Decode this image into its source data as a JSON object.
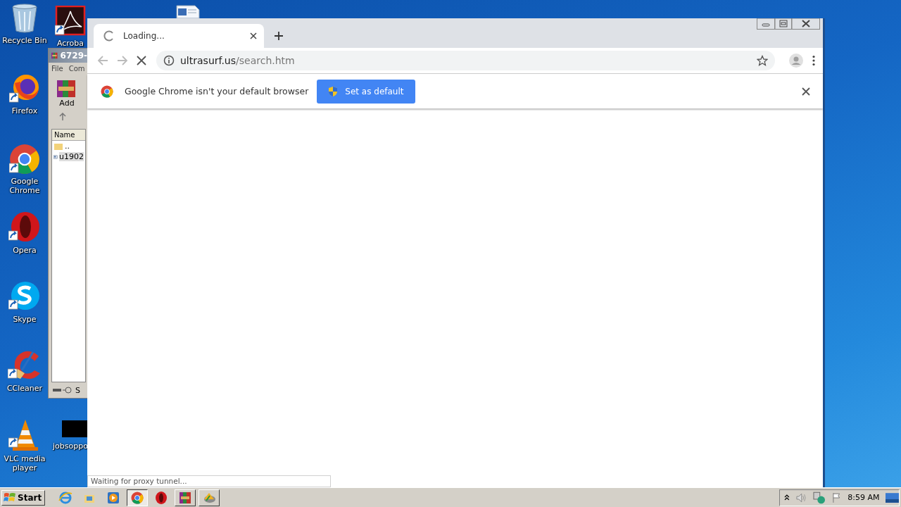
{
  "desktop_icons": [
    {
      "label": "Recycle Bin",
      "kind": "recycle"
    },
    {
      "label": "Firefox",
      "kind": "firefox"
    },
    {
      "label": "Google Chrome",
      "kind": "chrome"
    },
    {
      "label": "Opera",
      "kind": "opera"
    },
    {
      "label": "Skype",
      "kind": "skype"
    },
    {
      "label": "CCleaner",
      "kind": "ccleaner"
    },
    {
      "label": "VLC media player",
      "kind": "vlc"
    },
    {
      "label": "Acroba",
      "kind": "acrobat"
    },
    {
      "label": "jobsoppo",
      "kind": "thumbnail"
    },
    {
      "kind": "document"
    }
  ],
  "archive_window": {
    "title": "6729-",
    "menu": [
      "File",
      "Com"
    ],
    "toolbar": [
      "Add"
    ],
    "columns": [
      "Name"
    ],
    "rows": [
      {
        "name": "..",
        "kind": "folder"
      },
      {
        "name": "u1902",
        "kind": "file"
      }
    ],
    "status": "S"
  },
  "browser": {
    "loading": true,
    "tabs": [
      {
        "title": "Loading...",
        "selected": true
      }
    ],
    "address": {
      "host": "ultrasurf.us",
      "path": "/search.htm"
    },
    "infobar": {
      "message": "Google Chrome isn't your default browser",
      "button": "Set as default"
    },
    "status_bubble": "Waiting for proxy tunnel..."
  },
  "taskbar": {
    "start": "Start",
    "apps": [
      {
        "kind": "ie",
        "window": false,
        "selected": false
      },
      {
        "kind": "explorer",
        "window": false,
        "selected": false
      },
      {
        "kind": "media",
        "window": false,
        "selected": false
      },
      {
        "kind": "chrome",
        "window": true,
        "selected": true
      },
      {
        "kind": "opera",
        "window": false,
        "selected": false
      },
      {
        "kind": "winrar",
        "window": true,
        "selected": false
      },
      {
        "kind": "installer",
        "window": true,
        "selected": false
      }
    ],
    "clock": "8:59 AM"
  }
}
